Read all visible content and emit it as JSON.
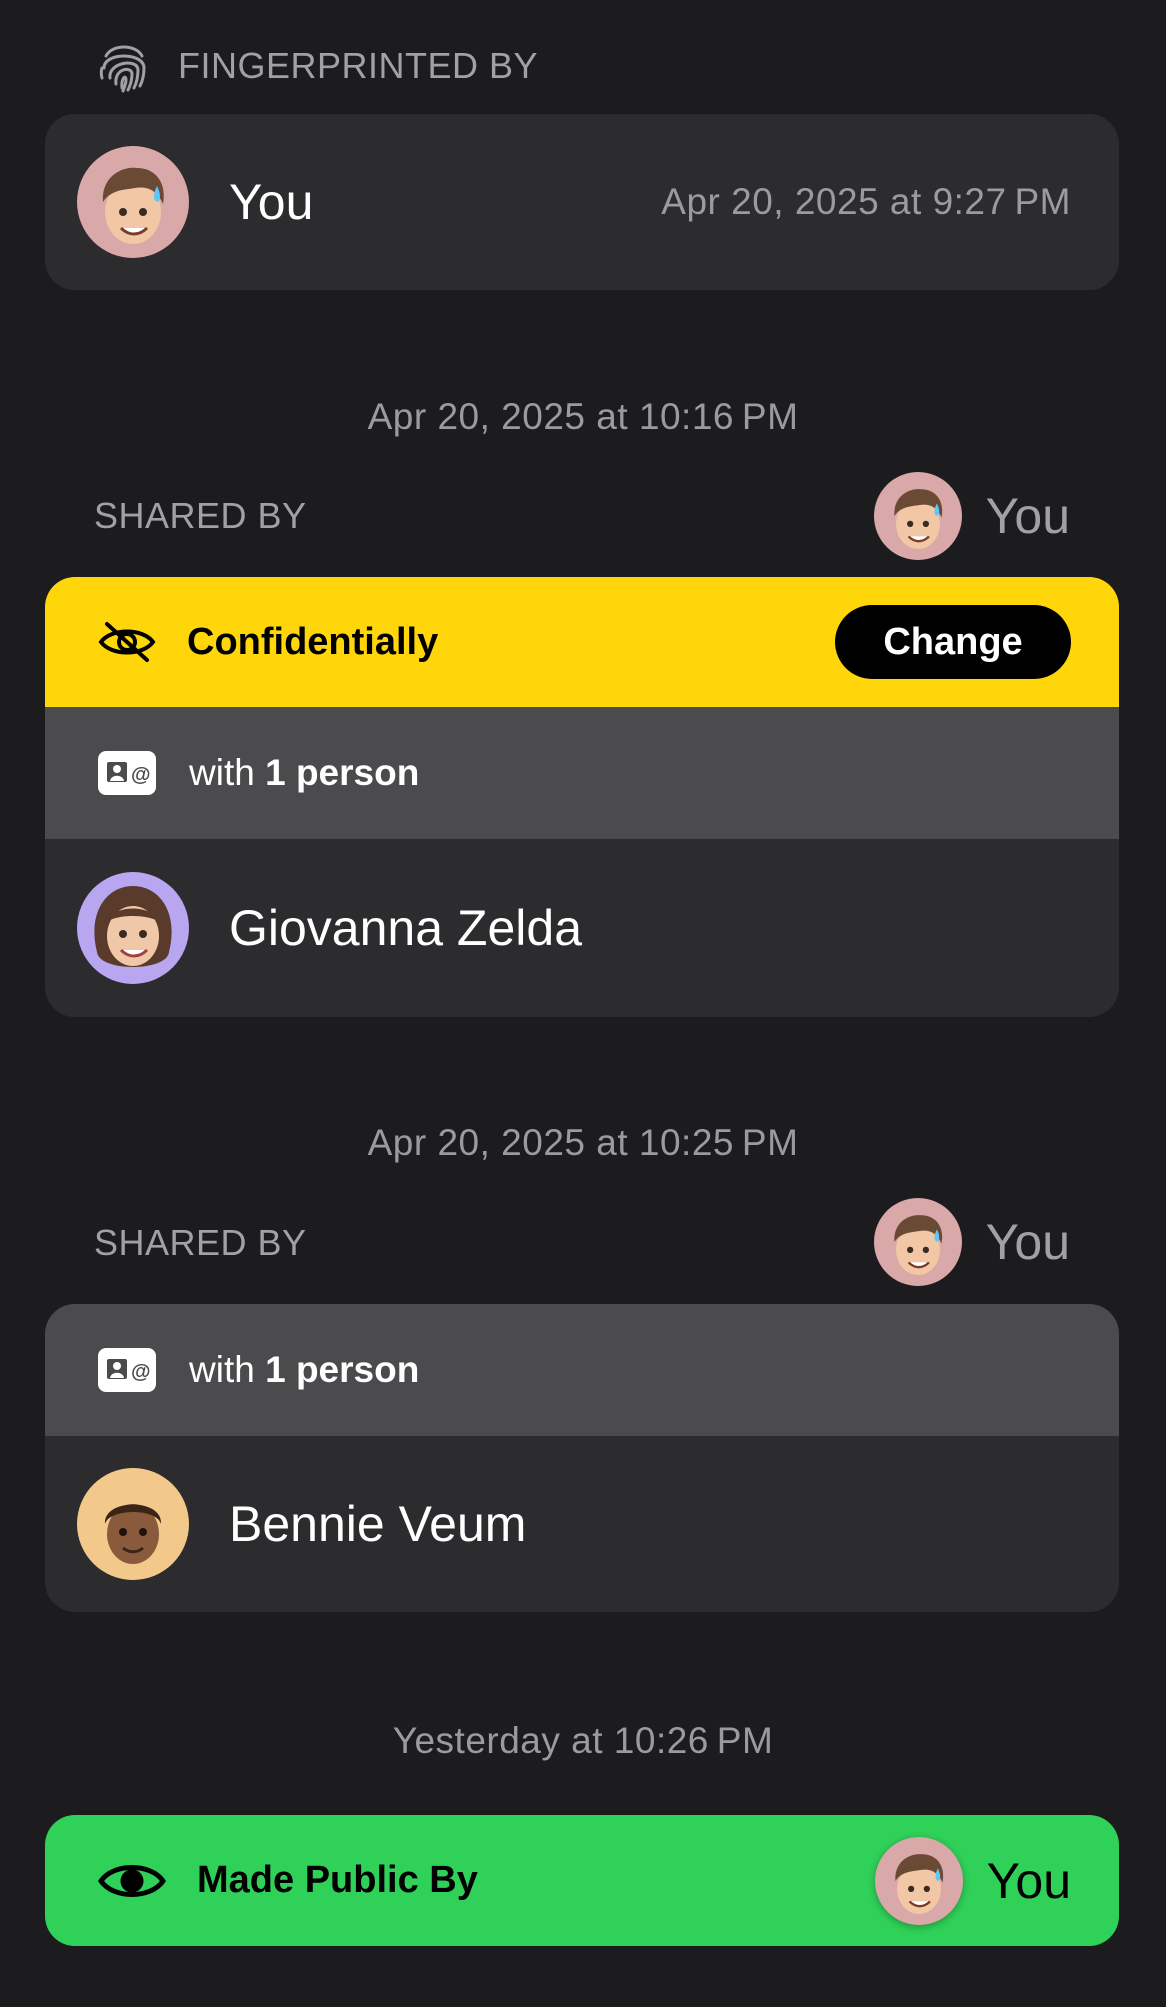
{
  "fingerprint": {
    "header_label": "FINGERPRINTED BY",
    "user_name": "You",
    "timestamp": "Apr 20, 2025 at 9:27 PM"
  },
  "share1": {
    "timestamp": "Apr 20, 2025 at 10:16 PM",
    "shared_by_label": "SHARED BY",
    "shared_by_name": "You",
    "visibility_label": "Confidentially",
    "change_label": "Change",
    "with_prefix": "with",
    "with_count": "1 person",
    "recipient_name": "Giovanna Zelda"
  },
  "share2": {
    "timestamp": "Apr 20, 2025 at 10:25 PM",
    "shared_by_label": "SHARED BY",
    "shared_by_name": "You",
    "with_prefix": "with",
    "with_count": "1 person",
    "recipient_name": "Bennie Veum"
  },
  "public": {
    "timestamp": "Yesterday at 10:26 PM",
    "label": "Made Public By",
    "name": "You"
  },
  "colors": {
    "background": "#1c1c1e",
    "card": "#2c2c2e",
    "confidential_band": "#ffd60a",
    "recipients_band": "#4b4b4d",
    "public_band": "#30d158"
  }
}
